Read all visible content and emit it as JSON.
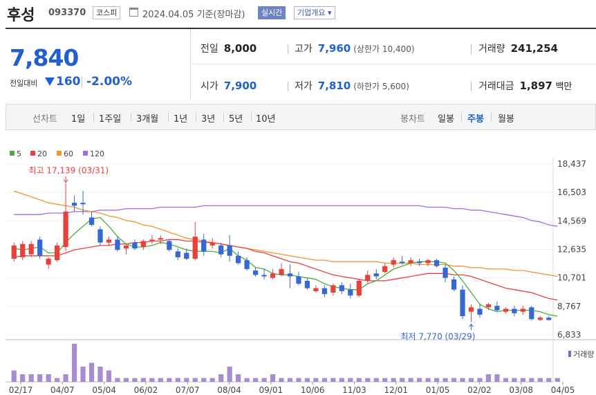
{
  "header": {
    "name": "후성",
    "code": "093370",
    "market": "코스피",
    "date": "2024.04.05 기준(장마감)",
    "realtime": "실시간",
    "company_info": "기업개요 ▾"
  },
  "price": {
    "current": "7,840",
    "change_label": "전일대비",
    "change": "160",
    "change_pct": "-2.00%"
  },
  "stats": {
    "prev_close_label": "전일",
    "prev_close": "8,000",
    "high_label": "고가",
    "high": "7,960",
    "upper_limit": "(상한가 10,400)",
    "volume_label": "거래량",
    "volume": "241,254",
    "open_label": "시가",
    "open": "7,900",
    "low_label": "저가",
    "low": "7,810",
    "lower_limit": "(하한가 5,600)",
    "amount_label": "거래대금",
    "amount": "1,897",
    "amount_unit": "백만"
  },
  "tabs": {
    "line_label": "선차트",
    "line_items": [
      "1일",
      "1주일",
      "3개월",
      "1년",
      "3년",
      "5년",
      "10년"
    ],
    "candle_label": "봉차트",
    "candle_items": [
      "일봉",
      "주봉",
      "월봉"
    ],
    "selected": "주봉"
  },
  "chart_data": {
    "type": "candlestick",
    "period": "weekly",
    "legend": [
      {
        "name": "5",
        "color": "#44b03a"
      },
      {
        "name": "20",
        "color": "#e8413b"
      },
      {
        "name": "60",
        "color": "#f29530"
      },
      {
        "name": "120",
        "color": "#a56ce0"
      }
    ],
    "y_ticks": [
      "18,437",
      "16,503",
      "14,569",
      "12,635",
      "10,701",
      "8,767",
      "6,833"
    ],
    "ylim": [
      6833,
      18437
    ],
    "x_ticks": [
      "02/17",
      "04/07",
      "05/04",
      "06/02",
      "07/07",
      "08/04",
      "09/01",
      "10/06",
      "11/03",
      "12/01",
      "01/05",
      "02/02",
      "03/08",
      "04/05"
    ],
    "max_annotation": "최고 17,139 (03/31)",
    "min_annotation": "최저 7,770 (03/29)",
    "volume_label": "거래량",
    "up_color": "#e8413b",
    "down_color": "#3567d6",
    "candles": [
      {
        "o": 12000,
        "h": 13100,
        "l": 11800,
        "c": 12900
      },
      {
        "o": 12100,
        "h": 13200,
        "l": 11900,
        "c": 13000
      },
      {
        "o": 12300,
        "h": 13200,
        "l": 12100,
        "c": 13000
      },
      {
        "o": 13300,
        "h": 13500,
        "l": 12000,
        "c": 12200
      },
      {
        "o": 11600,
        "h": 12100,
        "l": 11300,
        "c": 12000
      },
      {
        "o": 11900,
        "h": 13100,
        "l": 11800,
        "c": 12900
      },
      {
        "o": 12800,
        "h": 17139,
        "l": 12500,
        "c": 15200
      },
      {
        "o": 15800,
        "h": 16300,
        "l": 15200,
        "c": 15600
      },
      {
        "o": 15800,
        "h": 16600,
        "l": 15000,
        "c": 15700
      },
      {
        "o": 14800,
        "h": 15200,
        "l": 14200,
        "c": 14300
      },
      {
        "o": 14000,
        "h": 14200,
        "l": 12900,
        "c": 13100
      },
      {
        "o": 13100,
        "h": 13500,
        "l": 12900,
        "c": 13300
      },
      {
        "o": 13300,
        "h": 13500,
        "l": 12500,
        "c": 12600
      },
      {
        "o": 12700,
        "h": 13000,
        "l": 12300,
        "c": 12900
      },
      {
        "o": 13100,
        "h": 13300,
        "l": 12600,
        "c": 12700
      },
      {
        "o": 12800,
        "h": 13300,
        "l": 12600,
        "c": 13200
      },
      {
        "o": 13200,
        "h": 13600,
        "l": 13000,
        "c": 13300
      },
      {
        "o": 13300,
        "h": 13600,
        "l": 13000,
        "c": 13400
      },
      {
        "o": 13200,
        "h": 13300,
        "l": 12500,
        "c": 12600
      },
      {
        "o": 12500,
        "h": 12700,
        "l": 11900,
        "c": 12100
      },
      {
        "o": 12400,
        "h": 12700,
        "l": 11900,
        "c": 12000
      },
      {
        "o": 12000,
        "h": 14500,
        "l": 11900,
        "c": 13500
      },
      {
        "o": 13300,
        "h": 13700,
        "l": 12200,
        "c": 12500
      },
      {
        "o": 12900,
        "h": 13400,
        "l": 12700,
        "c": 13100
      },
      {
        "o": 12900,
        "h": 13100,
        "l": 12100,
        "c": 12300
      },
      {
        "o": 12900,
        "h": 13600,
        "l": 11800,
        "c": 12200
      },
      {
        "o": 12200,
        "h": 12500,
        "l": 11600,
        "c": 11700
      },
      {
        "o": 11900,
        "h": 12100,
        "l": 11200,
        "c": 11300
      },
      {
        "o": 11200,
        "h": 11400,
        "l": 10800,
        "c": 10900
      },
      {
        "o": 10900,
        "h": 11300,
        "l": 10600,
        "c": 10800
      },
      {
        "o": 10700,
        "h": 11300,
        "l": 10600,
        "c": 11000
      },
      {
        "o": 10900,
        "h": 11700,
        "l": 10800,
        "c": 11300
      },
      {
        "o": 11000,
        "h": 11600,
        "l": 10000,
        "c": 10800
      },
      {
        "o": 10800,
        "h": 11100,
        "l": 10200,
        "c": 10300
      },
      {
        "o": 10500,
        "h": 10700,
        "l": 9900,
        "c": 10000
      },
      {
        "o": 9800,
        "h": 10200,
        "l": 9700,
        "c": 10000
      },
      {
        "o": 10000,
        "h": 10200,
        "l": 9400,
        "c": 9600
      },
      {
        "o": 9700,
        "h": 10300,
        "l": 9500,
        "c": 10200
      },
      {
        "o": 10200,
        "h": 10400,
        "l": 9600,
        "c": 9800
      },
      {
        "o": 9900,
        "h": 10300,
        "l": 9300,
        "c": 9500
      },
      {
        "o": 9500,
        "h": 10600,
        "l": 9400,
        "c": 10500
      },
      {
        "o": 10500,
        "h": 11200,
        "l": 10300,
        "c": 10900
      },
      {
        "o": 11000,
        "h": 11300,
        "l": 10600,
        "c": 10800
      },
      {
        "o": 11100,
        "h": 11700,
        "l": 11000,
        "c": 11500
      },
      {
        "o": 11600,
        "h": 12100,
        "l": 11400,
        "c": 11900
      },
      {
        "o": 11800,
        "h": 12200,
        "l": 11600,
        "c": 11700
      },
      {
        "o": 11700,
        "h": 12100,
        "l": 11500,
        "c": 11900
      },
      {
        "o": 11800,
        "h": 12000,
        "l": 11500,
        "c": 11700
      },
      {
        "o": 11700,
        "h": 12000,
        "l": 11500,
        "c": 11900
      },
      {
        "o": 11900,
        "h": 12000,
        "l": 11400,
        "c": 11500
      },
      {
        "o": 11400,
        "h": 11600,
        "l": 10400,
        "c": 10700
      },
      {
        "o": 10600,
        "h": 10800,
        "l": 9800,
        "c": 9900
      },
      {
        "o": 9900,
        "h": 10200,
        "l": 7900,
        "c": 8100
      },
      {
        "o": 8400,
        "h": 8900,
        "l": 7700,
        "c": 8700
      },
      {
        "o": 8600,
        "h": 8900,
        "l": 8000,
        "c": 8200
      },
      {
        "o": 8700,
        "h": 9000,
        "l": 8500,
        "c": 8900
      },
      {
        "o": 8800,
        "h": 9100,
        "l": 8400,
        "c": 8500
      },
      {
        "o": 8400,
        "h": 8700,
        "l": 8300,
        "c": 8600
      },
      {
        "o": 8600,
        "h": 8800,
        "l": 8100,
        "c": 8300
      },
      {
        "o": 8400,
        "h": 8800,
        "l": 8200,
        "c": 8600
      },
      {
        "o": 8700,
        "h": 8800,
        "l": 7800,
        "c": 7900
      },
      {
        "o": 7850,
        "h": 8100,
        "l": 7770,
        "c": 8000
      },
      {
        "o": 8000,
        "h": 8100,
        "l": 7800,
        "c": 7840
      }
    ],
    "ma5": [
      12700,
      12600,
      12700,
      12800,
      12400,
      12400,
      13100,
      13700,
      14200,
      14700,
      14800,
      14200,
      13500,
      13000,
      12800,
      12800,
      12900,
      13100,
      13000,
      12800,
      12600,
      12500,
      12500,
      12500,
      12400,
      12700,
      12200,
      11900,
      11400,
      11300,
      11000,
      10900,
      10900,
      10800,
      10700,
      10600,
      10300,
      10100,
      10000,
      9900,
      9900,
      10300,
      10500,
      10900,
      11300,
      11500,
      11700,
      11800,
      11800,
      11800,
      11700,
      11200,
      10500,
      9700,
      8900,
      8600,
      8400,
      8500,
      8500,
      8500,
      8500,
      8400,
      8200,
      8100
    ],
    "ma20": [
      12100,
      12200,
      12200,
      12200,
      12200,
      12200,
      12400,
      12600,
      12700,
      12800,
      12900,
      12900,
      13000,
      13000,
      13100,
      13100,
      13200,
      13200,
      13300,
      13300,
      13200,
      13200,
      13100,
      13100,
      13000,
      12900,
      12800,
      12700,
      12500,
      12400,
      12200,
      12000,
      11800,
      11700,
      11500,
      11300,
      11100,
      10900,
      10800,
      10700,
      10600,
      10500,
      10500,
      10500,
      10600,
      10700,
      10800,
      10900,
      11000,
      11000,
      11000,
      10900,
      10900,
      10800,
      10600,
      10400,
      10200,
      10000,
      9900,
      9800,
      9700,
      9500,
      9300,
      9200
    ],
    "ma60": [
      16600,
      16400,
      16200,
      16000,
      15800,
      15700,
      15600,
      15500,
      15300,
      15200,
      15100,
      14900,
      14800,
      14600,
      14500,
      14300,
      14200,
      14000,
      13800,
      13600,
      13400,
      13300,
      13200,
      13100,
      13000,
      12900,
      12800,
      12700,
      12600,
      12500,
      12400,
      12300,
      12200,
      12100,
      12000,
      11900,
      11900,
      11800,
      11800,
      11800,
      11800,
      11800,
      11800,
      11700,
      11700,
      11700,
      11700,
      11600,
      11600,
      11600,
      11600,
      11500,
      11500,
      11400,
      11400,
      11300,
      11300,
      11300,
      11200,
      11200,
      11100,
      11000,
      10900,
      10800
    ],
    "ma120": [
      15000,
      15000,
      15000,
      15000,
      15100,
      15100,
      15100,
      15200,
      15200,
      15200,
      15300,
      15300,
      15300,
      15400,
      15400,
      15400,
      15400,
      15500,
      15500,
      15500,
      15500,
      15500,
      15600,
      15600,
      15600,
      15600,
      15600,
      15600,
      15600,
      15600,
      15600,
      15600,
      15600,
      15600,
      15600,
      15600,
      15600,
      15600,
      15600,
      15600,
      15600,
      15600,
      15600,
      15600,
      15600,
      15600,
      15600,
      15600,
      15500,
      15500,
      15500,
      15400,
      15400,
      15300,
      15300,
      15200,
      15100,
      15000,
      14900,
      14800,
      14600,
      14500,
      14300,
      14200
    ],
    "volumes": [
      3,
      2,
      2,
      2,
      2,
      1,
      2,
      10,
      4,
      5,
      4,
      3,
      1,
      1,
      1,
      1,
      1,
      1,
      1,
      1,
      1,
      1,
      1,
      1,
      2,
      4,
      2,
      1,
      1,
      1,
      2,
      1,
      1,
      1,
      1,
      1,
      1,
      1,
      1,
      1,
      1,
      1,
      1,
      1,
      1,
      1,
      1,
      1,
      1,
      1,
      1,
      1,
      1,
      1,
      1,
      2,
      2,
      1,
      1,
      1,
      1,
      1,
      1,
      1
    ]
  }
}
